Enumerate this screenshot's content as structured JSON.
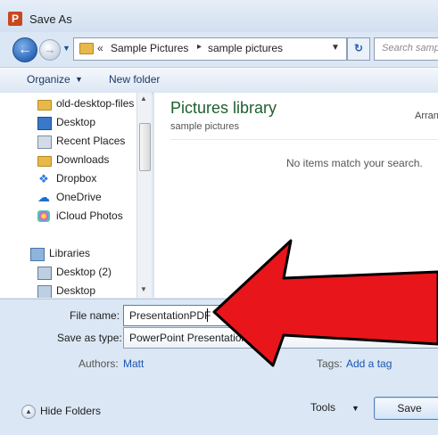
{
  "window": {
    "title": "Save As",
    "app_icon_letter": "P"
  },
  "address_bar": {
    "chevron": "«",
    "crumbs": [
      "Sample Pictures",
      "sample pictures"
    ],
    "separator": "▸",
    "search_placeholder": "Search samp"
  },
  "toolbar": {
    "organize_label": "Organize",
    "new_folder_label": "New folder"
  },
  "nav": {
    "items": [
      {
        "label": "old-desktop-files",
        "icon": "folder-icon"
      },
      {
        "label": "Desktop",
        "icon": "desktop-icon"
      },
      {
        "label": "Recent Places",
        "icon": "recent-places-icon"
      },
      {
        "label": "Downloads",
        "icon": "folder-icon"
      },
      {
        "label": "Dropbox",
        "icon": "dropbox-icon"
      },
      {
        "label": "OneDrive",
        "icon": "onedrive-icon"
      },
      {
        "label": "iCloud Photos",
        "icon": "icloud-photos-icon"
      },
      {
        "label": "Libraries",
        "icon": "libraries-icon"
      },
      {
        "label": "Desktop (2)",
        "icon": "desktop-library-icon"
      },
      {
        "label": "Desktop",
        "icon": "desktop-library-icon"
      }
    ]
  },
  "content": {
    "library_title": "Pictures library",
    "library_subtitle": "sample pictures",
    "arrange_label": "Arran",
    "empty_message": "No items match your search."
  },
  "form": {
    "file_name_label": "File name:",
    "file_name_value": "PresentationPDF",
    "save_as_type_label": "Save as type:",
    "save_as_type_value": "PowerPoint Presentation",
    "authors_label": "Authors:",
    "authors_value": "Matt",
    "tags_label": "Tags:",
    "tags_value": "Add a tag"
  },
  "footer": {
    "hide_folders_label": "Hide Folders",
    "tools_label": "Tools",
    "save_label": "Save"
  },
  "colors": {
    "accent": "#3a78c9",
    "annotation_arrow": "#e8151b",
    "library_title": "#1e5f2f"
  }
}
